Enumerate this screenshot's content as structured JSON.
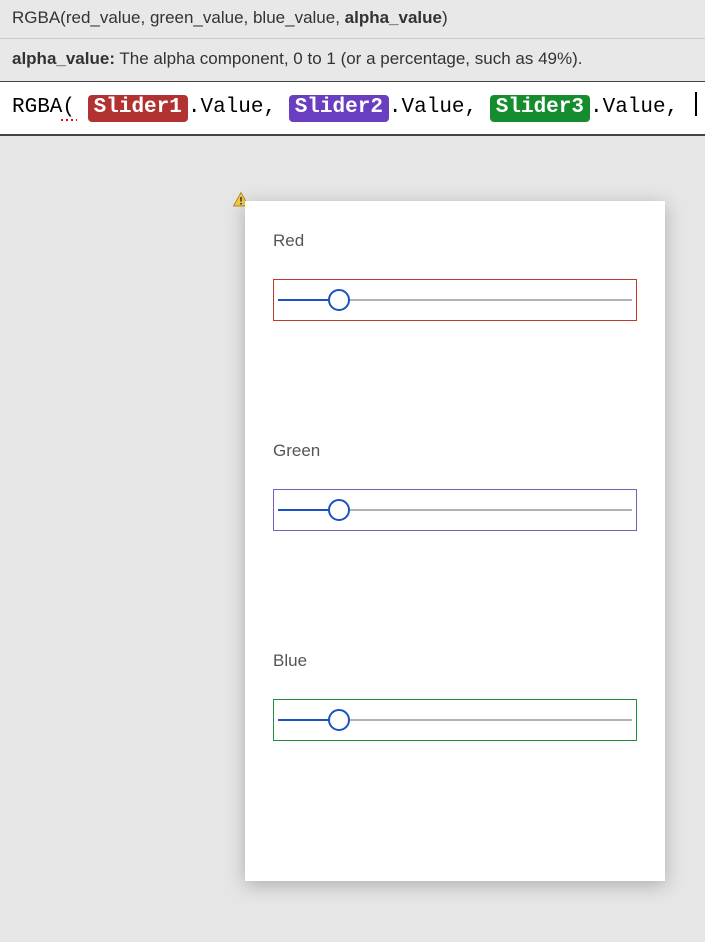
{
  "tooltip": {
    "signature_prefix": "RGBA(red_value, green_value, blue_value, ",
    "signature_active_param": "alpha_value",
    "signature_suffix": ")",
    "param_label": "alpha_value:",
    "param_desc": " The alpha component, 0 to 1 (or a percentage, such as 49%)."
  },
  "formula": {
    "fn_name": "RGBA",
    "open_paren": "(",
    "arg1_control": "Slider1",
    "arg2_control": "Slider2",
    "arg3_control": "Slider3",
    "dot_prop": ".Value",
    "comma": ","
  },
  "sliders": {
    "red": {
      "label": "Red",
      "value_pct": 18,
      "border": "red"
    },
    "green": {
      "label": "Green",
      "value_pct": 18,
      "border": "purple"
    },
    "blue": {
      "label": "Blue",
      "value_pct": 18,
      "border": "green"
    }
  },
  "colors": {
    "pill_red": "#b23232",
    "pill_purple": "#6a3ec0",
    "pill_green": "#158c2e",
    "accent": "#1a52c4"
  }
}
